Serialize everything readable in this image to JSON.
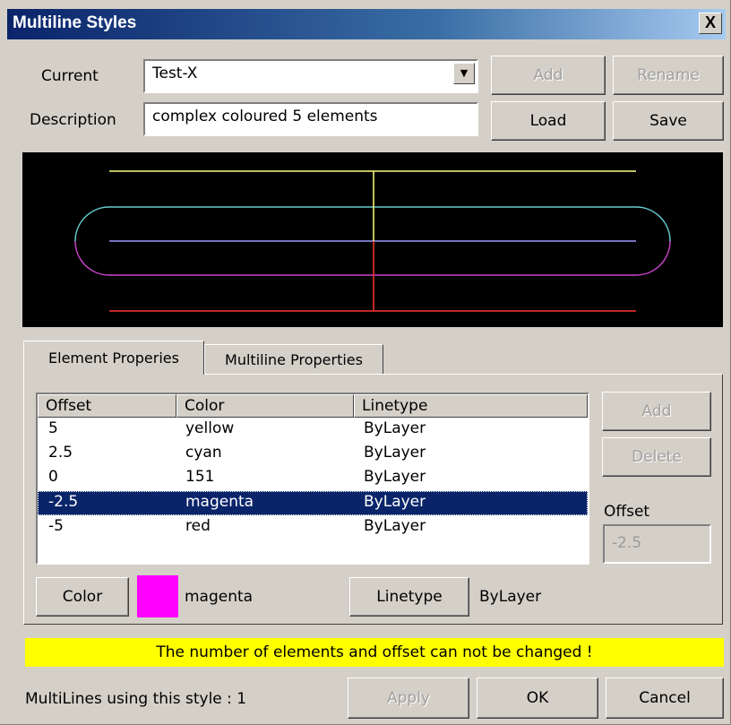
{
  "window": {
    "title": "Multiline Styles",
    "close_glyph": "X"
  },
  "header": {
    "current_label": "Current",
    "current_value": "Test-X",
    "description_label": "Description",
    "description_value": "complex coloured 5 elements",
    "add_label": "Add",
    "rename_label": "Rename",
    "load_label": "Load",
    "save_label": "Save"
  },
  "preview": {
    "background": "#000000",
    "line_colors": [
      "#ffff80",
      "#66cccc",
      "#9999ff",
      "#cc44cc",
      "#ff3333"
    ]
  },
  "tabs": [
    {
      "label": "Element Properies",
      "active": true
    },
    {
      "label": "Multiline Properties",
      "active": false
    }
  ],
  "elements": {
    "columns": [
      "Offset",
      "Color",
      "Linetype"
    ],
    "rows": [
      {
        "offset": "5",
        "color": "yellow",
        "linetype": "ByLayer",
        "selected": false
      },
      {
        "offset": "2.5",
        "color": "cyan",
        "linetype": "ByLayer",
        "selected": false
      },
      {
        "offset": "0",
        "color": "151",
        "linetype": "ByLayer",
        "selected": false
      },
      {
        "offset": "-2.5",
        "color": "magenta",
        "linetype": "ByLayer",
        "selected": true
      },
      {
        "offset": "-5",
        "color": "red",
        "linetype": "ByLayer",
        "selected": false
      }
    ],
    "add_label": "Add",
    "delete_label": "Delete",
    "offset_label": "Offset",
    "offset_value": "-2.5"
  },
  "element_props": {
    "color_button": "Color",
    "color_name": "magenta",
    "swatch_color": "#ff00ff",
    "linetype_button": "Linetype",
    "linetype_value": "ByLayer"
  },
  "banner": {
    "text": "The number of elements and offset can not be changed !",
    "color": "#ffff00"
  },
  "footer": {
    "status": "MultiLines using this style : 1",
    "apply_label": "Apply",
    "ok_label": "OK",
    "cancel_label": "Cancel"
  }
}
